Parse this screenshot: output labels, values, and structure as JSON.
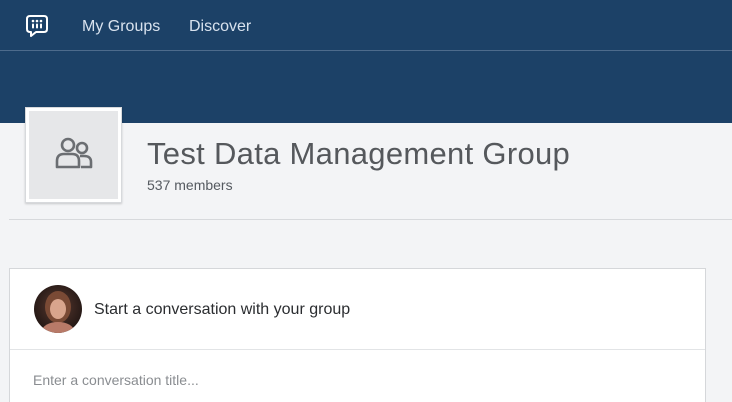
{
  "nav": {
    "logo_icon": "speech-bubble-icon",
    "items": [
      {
        "label": "My Groups"
      },
      {
        "label": "Discover"
      }
    ]
  },
  "group": {
    "icon": "group-people-icon",
    "title": "Test Data Management Group",
    "members": "537 members"
  },
  "composer": {
    "prompt": "Start a conversation with your group",
    "title_placeholder": "Enter a conversation title...",
    "title_value": ""
  },
  "colors": {
    "header_bg": "#1c4167",
    "page_bg": "#f3f4f6",
    "nav_text": "#d8e2ee"
  }
}
